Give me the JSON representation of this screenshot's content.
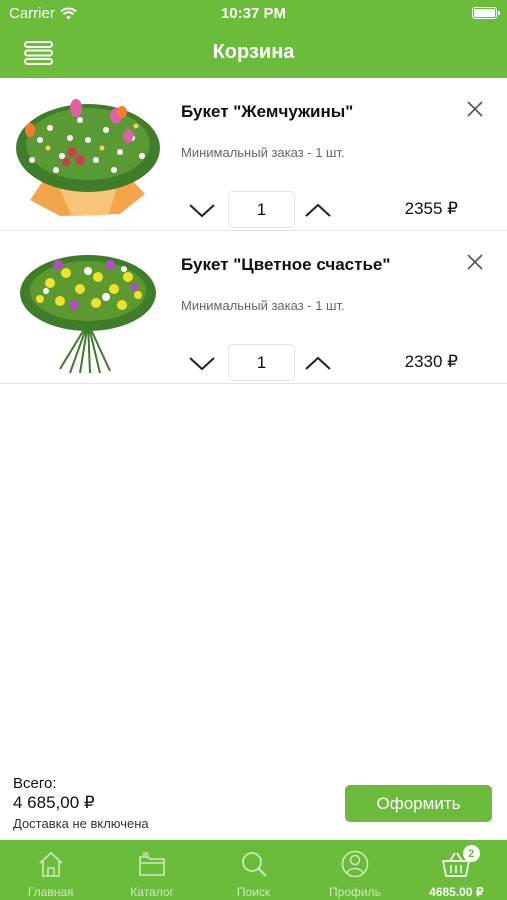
{
  "status_bar": {
    "carrier": "Carrier",
    "time": "10:37 PM"
  },
  "nav": {
    "title": "Корзина"
  },
  "cart": {
    "items": [
      {
        "name": "Букет \"Жемчужины\"",
        "min_order": "Минимальный заказ - 1 шт.",
        "quantity": "1",
        "price": "2355 ₽"
      },
      {
        "name": "Букет \"Цветное счастье\"",
        "min_order": "Минимальный заказ - 1 шт.",
        "quantity": "1",
        "price": "2330 ₽"
      }
    ]
  },
  "summary": {
    "label": "Всего:",
    "total": "4 685,00 ₽",
    "delivery_note": "Доставка не включена",
    "checkout_label": "Оформить"
  },
  "tabbar": {
    "tabs": [
      {
        "label": "Главная",
        "icon": "home-icon"
      },
      {
        "label": "Каталог",
        "icon": "folder-icon"
      },
      {
        "label": "Поиск",
        "icon": "search-icon"
      },
      {
        "label": "Профиль",
        "icon": "profile-icon"
      },
      {
        "label": "4685.00 ₽",
        "icon": "basket-icon",
        "badge": "2"
      }
    ]
  },
  "colors": {
    "accent": "#6abc3a",
    "tab_inactive": "#cfe9bd"
  }
}
